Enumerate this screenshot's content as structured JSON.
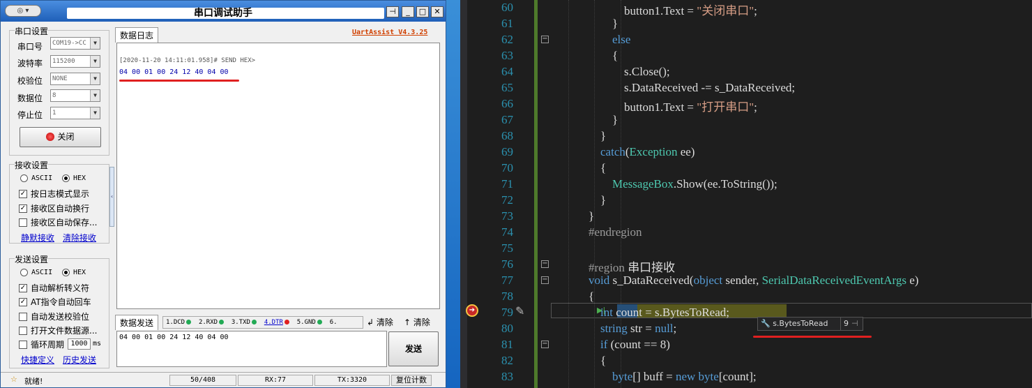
{
  "app": {
    "title": "串口调试助手",
    "version": "UartAssist V4.3.25",
    "sys_label": "◎ ▾"
  },
  "serial": {
    "group": "串口设置",
    "port_label": "串口号",
    "port": "COM19->CC",
    "baud_label": "波特率",
    "baud": "115200",
    "parity_label": "校验位",
    "parity": "NONE",
    "databits_label": "数据位",
    "databits": "8",
    "stopbits_label": "停止位",
    "stopbits": "1",
    "close_label": "关闭"
  },
  "recv": {
    "group": "接收设置",
    "ascii": "ASCII",
    "hex": "HEX",
    "opt1": "按日志模式显示",
    "opt2": "接收区自动换行",
    "opt3": "接收区自动保存...",
    "link1": "静默接收",
    "link2": "清除接收"
  },
  "send": {
    "group": "发送设置",
    "ascii": "ASCII",
    "hex": "HEX",
    "opt1": "自动解析转义符",
    "opt2": "AT指令自动回车",
    "opt3": "自动发送校验位",
    "opt4": "打开文件数据源...",
    "opt5": "循环周期",
    "period": "1000",
    "unit": "ms",
    "link1": "快捷定义",
    "link2": "历史发送"
  },
  "log": {
    "tab": "数据日志",
    "stamp": "[2020-11-20 14:11:01.958]# SEND HEX>",
    "data": "04 00 01 00 24 12 40 04 00"
  },
  "sendpanel": {
    "tab": "数据发送",
    "pins": [
      "1.DCD",
      "2.RXD",
      "3.TXD",
      "4.DTR",
      "5.GND",
      "6."
    ],
    "clear1": "清除",
    "clear2": "清除",
    "input": "04 00 01 00 24 12 40 04 00",
    "send_label": "发送"
  },
  "status": {
    "text": "就绪!",
    "count": "50/408",
    "rx": "RX:77",
    "tx": "TX:3320",
    "reset": "复位计数"
  },
  "editor": {
    "tooltip_expr": "s.BytesToRead",
    "tooltip_val": "9"
  },
  "colors": {
    "keyword": "#569cd6",
    "type": "#4ec9b0",
    "string": "#d69d85",
    "linenum": "#2b91af"
  }
}
